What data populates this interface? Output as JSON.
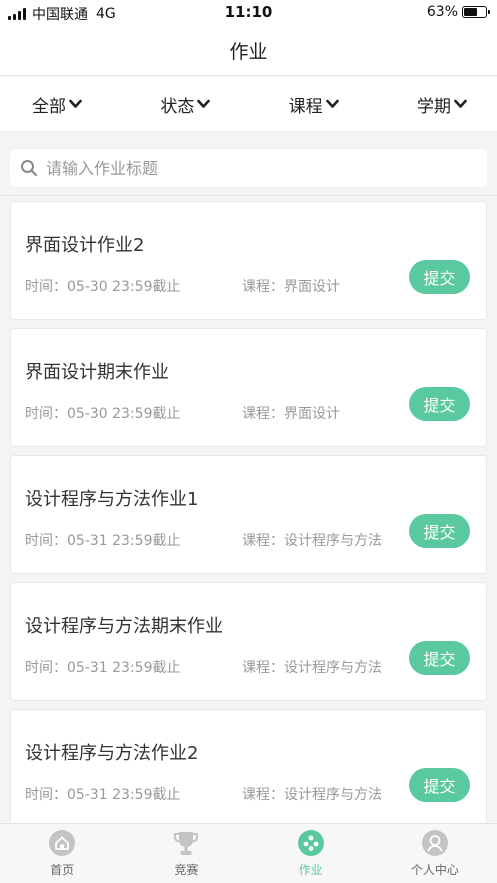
{
  "status_bar": {
    "carrier": "中国联通",
    "network": "4G",
    "time": "11:10",
    "battery": "63%",
    "battery_level": 0.63
  },
  "header": {
    "title": "作业"
  },
  "filters": [
    {
      "label": "全部"
    },
    {
      "label": "状态"
    },
    {
      "label": "课程"
    },
    {
      "label": "学期"
    }
  ],
  "search": {
    "placeholder": "请输入作业标题",
    "value": ""
  },
  "assignments": [
    {
      "title": "界面设计作业2",
      "time": "时间：05-30 23:59截止",
      "course": "课程：界面设计",
      "action": "提交"
    },
    {
      "title": "界面设计期末作业",
      "time": "时间：05-30 23:59截止",
      "course": "课程：界面设计",
      "action": "提交"
    },
    {
      "title": "设计程序与方法作业1",
      "time": "时间：05-31 23:59截止",
      "course": "课程：设计程序与方法",
      "action": "提交"
    },
    {
      "title": "设计程序与方法期末作业",
      "time": "时间：05-31 23:59截止",
      "course": "课程：设计程序与方法",
      "action": "提交"
    },
    {
      "title": "设计程序与方法作业2",
      "time": "时间：05-31 23:59截止",
      "course": "课程：设计程序与方法",
      "action": "提交"
    }
  ],
  "tabs": [
    {
      "label": "首页",
      "icon": "home-icon",
      "active": false
    },
    {
      "label": "竞赛",
      "icon": "trophy-icon",
      "active": false
    },
    {
      "label": "作业",
      "icon": "assignment-icon",
      "active": true
    },
    {
      "label": "个人中心",
      "icon": "profile-icon",
      "active": false
    }
  ],
  "colors": {
    "accent": "#5bc9a0",
    "inactive_icon": "#c4c4c4",
    "background": "#f4f4f4"
  }
}
